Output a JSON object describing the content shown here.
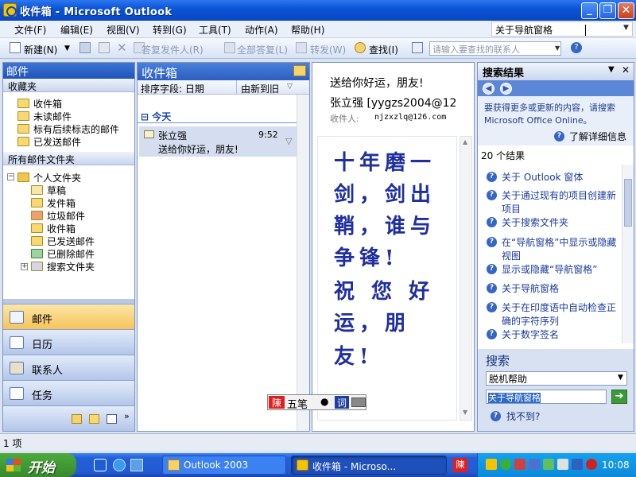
{
  "window": {
    "title": "收件箱 - Microsoft Outlook"
  },
  "menu": {
    "items": [
      "文件(F)",
      "编辑(E)",
      "视图(V)",
      "转到(G)",
      "工具(T)",
      "动作(A)",
      "帮助(H)"
    ],
    "help_box": "关于导航窗格"
  },
  "toolbar": {
    "new_label": "新建(N)",
    "reply_label": "答复发件人(R)",
    "reply_all_label": "全部答复(L)",
    "forward_label": "转发(W)",
    "find_label": "查找(I)",
    "contact_search_placeholder": "请输入要查找的联系人"
  },
  "nav": {
    "header": "邮件",
    "favorites_header": "收藏夹",
    "favorites": [
      "收件箱",
      "未读邮件",
      "标有后续标志的邮件",
      "已发送邮件"
    ],
    "all_folders_header": "所有邮件文件夹",
    "personal_folders": "个人文件夹",
    "folders": [
      "草稿",
      "发件箱",
      "垃圾邮件",
      "收件箱",
      "已发送邮件",
      "已删除邮件",
      "搜索文件夹"
    ],
    "buttons": [
      "邮件",
      "日历",
      "联系人",
      "任务"
    ]
  },
  "message_list": {
    "header": "收件箱",
    "sort_by": "排序字段: 日期",
    "sort_order": "由新到旧",
    "group": "今天",
    "messages": [
      {
        "sender": "张立强",
        "subject": "送给你好运，朋友!",
        "time": "9:52"
      }
    ]
  },
  "reading": {
    "subject": "送给你好运，朋友!",
    "from": "张立强 [yygzs2004@12",
    "to_label": "收件人:",
    "to": "njzxzlq@126.com",
    "body_lines": [
      "十年磨一",
      "剑，剑出",
      "鞘，谁与",
      "争锋!",
      "祝 您 好",
      "运，朋",
      "友!"
    ]
  },
  "task_pane": {
    "title": "搜索结果",
    "promo": "要获得更多或更新的内容，请搜索 Microsoft Office Online。",
    "learn_more": "了解详细信息",
    "count": "20 个结果",
    "results": [
      "关于 Outlook 窗体",
      "关于通过现有的项目创建新项目",
      "关于搜索文件夹",
      "在“导航窗格”中显示或隐藏视图",
      "显示或隐藏“导航窗格”",
      "关于导航窗格",
      "关于在印度语中自动检查正确的字符序列",
      "关于数字签名"
    ],
    "search_title": "搜索",
    "scope": "脱机帮助",
    "query": "关于导航窗格",
    "not_found": "找不到?"
  },
  "ime": {
    "lock": "陳",
    "mode": "五笔",
    "word": "词"
  },
  "status": {
    "items": "1 项"
  },
  "taskbar": {
    "start": "开始",
    "tasks": [
      "Outlook 2003",
      "收件箱 - Microso..."
    ],
    "time": "10:08"
  }
}
